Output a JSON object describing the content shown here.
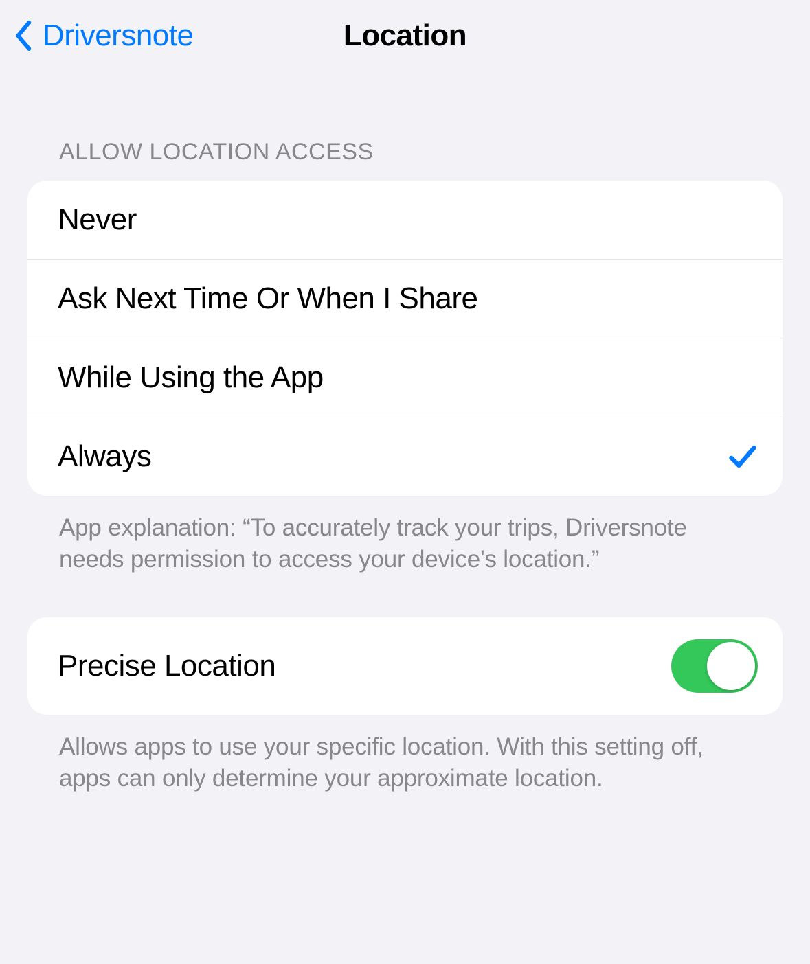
{
  "nav": {
    "back_label": "Driversnote",
    "title": "Location"
  },
  "section1": {
    "header": "ALLOW LOCATION ACCESS",
    "options": [
      {
        "label": "Never",
        "selected": false
      },
      {
        "label": "Ask Next Time Or When I Share",
        "selected": false
      },
      {
        "label": "While Using the App",
        "selected": false
      },
      {
        "label": "Always",
        "selected": true
      }
    ],
    "footer": "App explanation: “To accurately track your trips, Driversnote needs permission to access your device's location.”"
  },
  "section2": {
    "label": "Precise Location",
    "enabled": true,
    "footer": "Allows apps to use your specific location. With this setting off, apps can only determine your approximate location."
  }
}
